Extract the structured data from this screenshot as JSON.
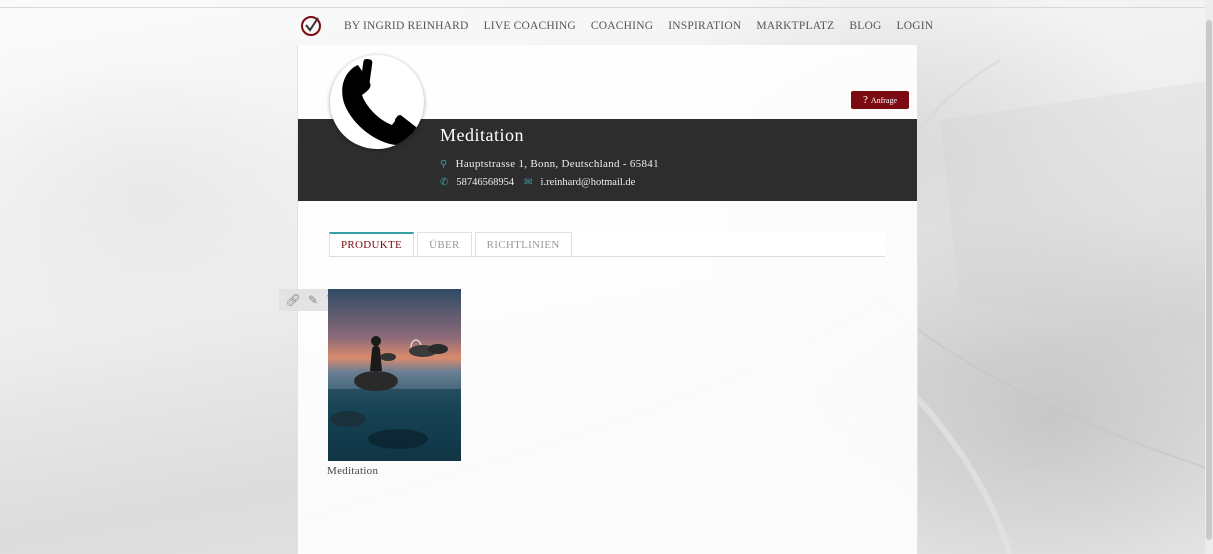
{
  "nav": {
    "items": [
      "BY INGRID REINHARD",
      "LIVE COACHING",
      "COACHING",
      "INSPIRATION",
      "MARKTPLATZ",
      "BLOG",
      "LOGIN"
    ]
  },
  "profile": {
    "name": "Meditation",
    "address": "Hauptstrasse 1, Bonn, Deutschland - 65841",
    "phone": "58746568954",
    "email": "i.reinhard@hotmail.de",
    "request_label": "Anfrage",
    "avatar_icon": "phone-icon"
  },
  "tabs": [
    {
      "label": "PRODUKTE",
      "active": true
    },
    {
      "label": "ÜBER",
      "active": false
    },
    {
      "label": "RICHTLINIEN",
      "active": false
    }
  ],
  "tools": [
    "link-icon",
    "edit-icon",
    "trash-icon"
  ],
  "products": [
    {
      "name": "Meditation"
    }
  ],
  "colors": {
    "accent": "#7a0b12",
    "teal": "#3aa0a8",
    "header_bg": "#2d2d2d"
  }
}
